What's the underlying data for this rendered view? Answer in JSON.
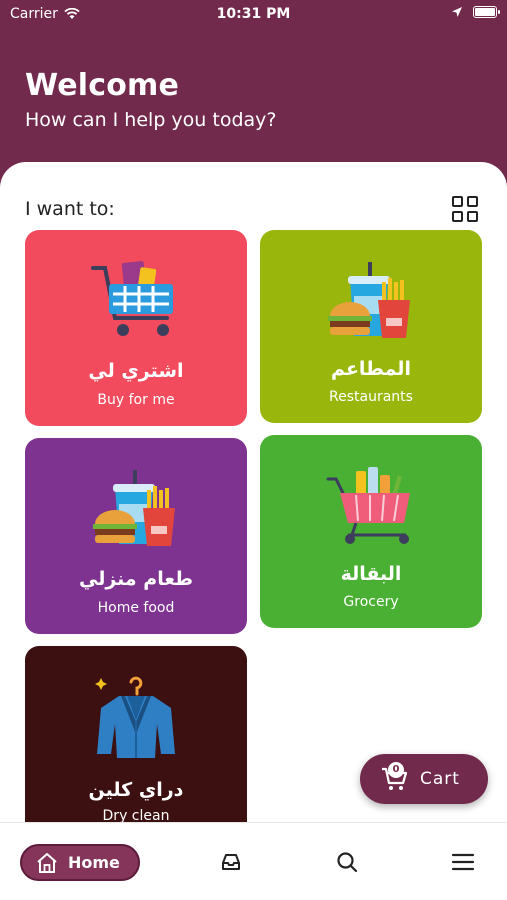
{
  "status_bar": {
    "carrier": "Carrier",
    "time": "10:31 PM"
  },
  "header": {
    "title": "Welcome",
    "subtitle": "How can I help you today?"
  },
  "section": {
    "label": "I want to:"
  },
  "categories": [
    {
      "arabic": "اشتري لي",
      "english": "Buy for me",
      "color": "#f24b5e",
      "icon": "shopping-cart-icon"
    },
    {
      "arabic": "المطاعم",
      "english": "Restaurants",
      "color": "#98b60c",
      "icon": "fast-food-icon"
    },
    {
      "arabic": "طعام منزلي",
      "english": "Home food",
      "color": "#7f3391",
      "icon": "fast-food-icon"
    },
    {
      "arabic": "البقالة",
      "english": "Grocery",
      "color": "#49b033",
      "icon": "grocery-basket-icon"
    },
    {
      "arabic": "دراي كلين",
      "english": "Dry clean",
      "color": "#3c0f10",
      "icon": "suit-hanger-icon"
    }
  ],
  "cart": {
    "label": "Cart",
    "count": "0"
  },
  "bottom_nav": {
    "home_label": "Home",
    "items": [
      "home-icon",
      "inbox-icon",
      "search-icon",
      "menu-icon"
    ]
  },
  "colors": {
    "brand": "#722a4c"
  }
}
